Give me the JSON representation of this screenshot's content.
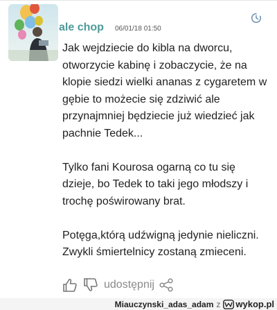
{
  "comment": {
    "author": "ale chop",
    "timestamp": "06/01/18 01:50",
    "paragraphs": [
      "Jak wejdziecie do kibla na dworcu, otworzycie kabinę i zobaczycie, że na klopie siedzi wielki ananas z cygaretem w gębie to możecie się zdziwić ale przynajmniej będziecie już wiedzieć jak pachnie Tedek...",
      "Tylko fani Kourosa ogarną co tu się dzieje, bo Tedek to taki jego młodszy i trochę poświrowany brat.",
      "Potęga,którą udźwigną jedynie nieliczni. Zwykli śmiertelnicy zostaną zmieceni."
    ],
    "share_label": "udostępnij"
  },
  "footer": {
    "username": "Miauczynski_adas_adam",
    "separator": "z",
    "site": "wykop.pl"
  },
  "icons": {
    "clock": "clock-icon",
    "like": "thumbs-up-icon",
    "dislike": "thumbs-down-icon",
    "share": "share-icon",
    "logo": "wykop-logo"
  },
  "colors": {
    "author": "#4f9a9a",
    "text": "#1f1f1f",
    "muted": "#8a8a8a"
  }
}
